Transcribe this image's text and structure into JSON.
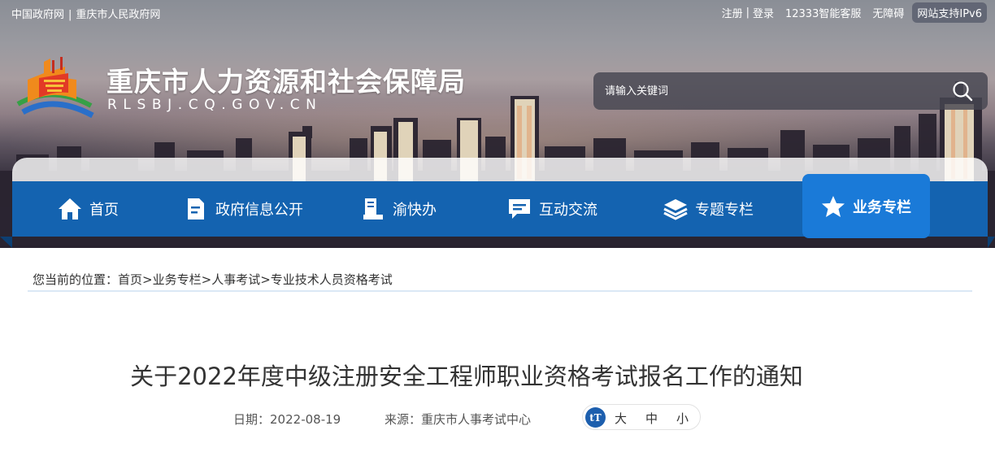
{
  "topbar": {
    "left_links": [
      "中国政府网",
      "重庆市人民政府网"
    ],
    "separator": "|",
    "register": "注册",
    "login": "登录",
    "service_line": "12333智能客服",
    "accessibility": "无障碍",
    "ipv6": "网站支持IPv6"
  },
  "site": {
    "title": "重庆市人力资源和社会保障局",
    "domain": "RLSBJ.CQ.GOV.CN"
  },
  "search": {
    "placeholder": "请输入关键词",
    "icon": "search-icon"
  },
  "nav": {
    "items": [
      {
        "label": "首页",
        "icon": "home-icon"
      },
      {
        "label": "政府信息公开",
        "icon": "document-icon"
      },
      {
        "label": "渝快办",
        "icon": "service-desk-icon"
      },
      {
        "label": "互动交流",
        "icon": "chat-icon"
      },
      {
        "label": "专题专栏",
        "icon": "layers-icon"
      },
      {
        "label": "业务专栏",
        "icon": "star-icon",
        "active": true
      }
    ],
    "active_color": "#1a7ad8",
    "bar_color": "#1463b0"
  },
  "breadcrumb": {
    "prefix": "您当前的位置：",
    "items": [
      "首页",
      "业务专栏",
      "人事考试",
      "专业技术人员资格考试"
    ],
    "separator": ">"
  },
  "article": {
    "title": "关于2022年度中级注册安全工程师职业资格考试报名工作的通知",
    "date_label": "日期：",
    "date": "2022-08-19",
    "source_label": "来源：",
    "source": "重庆市人事考试中心",
    "font_icon": "tT",
    "font_sizes": [
      "大",
      "中",
      "小"
    ]
  }
}
